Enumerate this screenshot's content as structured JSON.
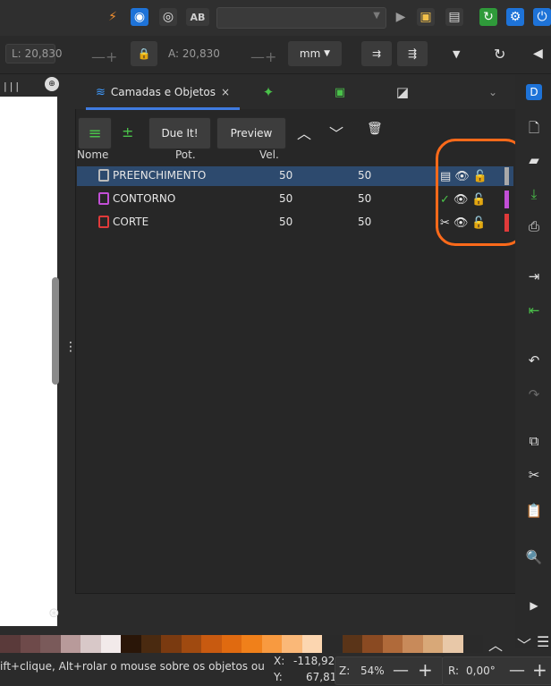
{
  "toolbar": {
    "ab_label": "AB",
    "fields": {
      "l_label": "L:",
      "l_value": "20,830",
      "a_label": "A:",
      "a_value": "20,830",
      "unit": "mm"
    }
  },
  "panel": {
    "tab_layers_label": "Camadas e Objetos",
    "tab_close_label": "×",
    "buttons": {
      "due_it": "Due It!",
      "preview": "Preview"
    },
    "columns": {
      "name": "Nome",
      "power": "Pot.",
      "speed": "Vel."
    },
    "rows": [
      {
        "name": "PREENCHIMENTO",
        "power": "50",
        "speed": "50",
        "color": "#a9a9a9"
      },
      {
        "name": "CONTORNO",
        "power": "50",
        "speed": "50",
        "color": "#c24fd6"
      },
      {
        "name": "CORTE",
        "power": "50",
        "speed": "50",
        "color": "#e03a3a"
      }
    ]
  },
  "statusbar": {
    "hint": "ift+clique, Alt+rolar o mouse sobre os objetos ou",
    "x_label": "X:",
    "x_value": "-118,92",
    "y_label": "Y:",
    "y_value": "67,81",
    "z_label": "Z:",
    "zoom": "54%",
    "r_label": "R:",
    "rotation": "0,00°"
  },
  "colors": {
    "accent": "#3f7be0",
    "annotation": "#ff6a1a",
    "selected_row": "#2d4a6e"
  },
  "palette": [
    "#5a3a3a",
    "#6e4a4a",
    "#7a5a5a",
    "#b89a9a",
    "#d8c8c8",
    "#f2eaea",
    "#2a1608",
    "#4a2a10",
    "#7a3a10",
    "#a04a10",
    "#c85a10",
    "#e06a10",
    "#f0801a",
    "#f89a40",
    "#fab878",
    "#fcd6b0",
    "#2a2a2a",
    "#5a3418",
    "#8a4a22",
    "#b06a3a",
    "#c88a5a",
    "#d8a878",
    "#e8c8a8",
    "#2a2a2a"
  ]
}
